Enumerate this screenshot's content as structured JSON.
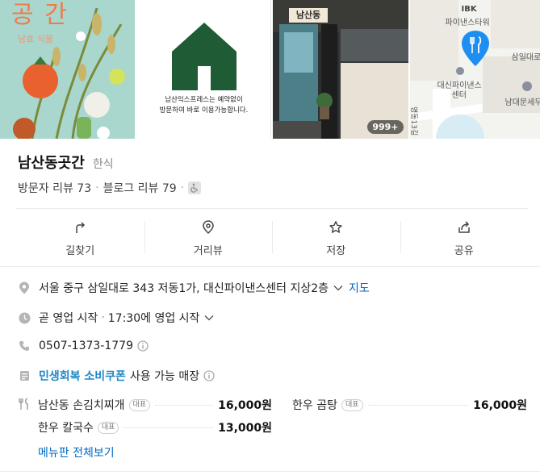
{
  "photos": {
    "poster_title": "공 간",
    "poster_sub": "남효 식물",
    "notice_line1": "남산익스프레스는 예약없이",
    "notice_line2": "방문하여 바로 이용가능합니다.",
    "store_sign": "남산동",
    "photo_count": "999+"
  },
  "map": {
    "ibk": "IBK",
    "ibk_tower": "파이낸스타워",
    "samil": "삼일대로",
    "daeshin1": "대신파이낸스",
    "daeshin2": "센터",
    "namdaemun": "남대문세무",
    "road": "명동13길",
    "pin_color": "#1e8ef0"
  },
  "place": {
    "name": "남산동곳간",
    "category": "한식",
    "visitor_reviews": "방문자 리뷰 73",
    "blog_reviews": "블로그 리뷰 79",
    "separator": "·"
  },
  "actions": [
    {
      "label": "길찾기",
      "icon": "directions-icon"
    },
    {
      "label": "거리뷰",
      "icon": "location-pin-icon"
    },
    {
      "label": "저장",
      "icon": "star-icon"
    },
    {
      "label": "공유",
      "icon": "share-icon"
    }
  ],
  "info": {
    "address": "서울 중구 삼일대로 343 저동1가, 대신파이낸스센터 지상2층",
    "map_link": "지도",
    "hours_status": "곧 영업 시작",
    "hours_separator": "·",
    "hours_detail": "17:30에 영업 시작",
    "phone": "0507-1373-1779",
    "coupon_highlight": "민생회복 소비쿠폰",
    "coupon_rest": "사용 가능 매장"
  },
  "menu": {
    "items": [
      {
        "name": "남산동 손김치찌개",
        "badge": "대표",
        "price": "16,000원"
      },
      {
        "name": "한우 곰탕",
        "badge": "대표",
        "price": "16,000원"
      },
      {
        "name": "한우 칼국수",
        "badge": "대표",
        "price": "13,000원"
      }
    ],
    "view_all": "메뉴판 전체보기"
  }
}
